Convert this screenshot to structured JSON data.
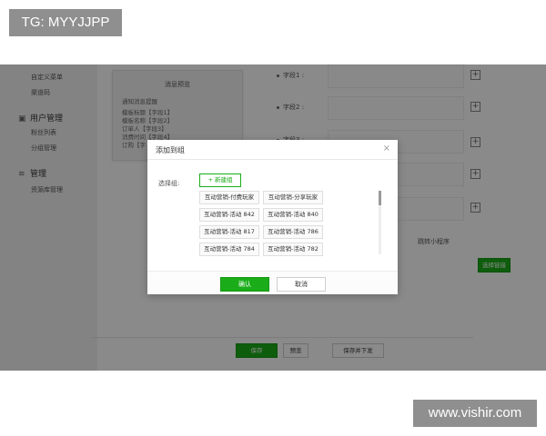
{
  "watermarks": {
    "top": "TG: MYYJJPP",
    "bottom": "www.vishir.com"
  },
  "sidebar": {
    "items_top": [
      "自定义菜单",
      "渠道码"
    ],
    "groups": [
      {
        "icon": "user-icon",
        "title": "用户管理",
        "items": [
          "粉丝列表",
          "分组管理"
        ]
      },
      {
        "icon": "manage-icon",
        "title": "管理",
        "items": [
          "资源库管理"
        ]
      }
    ]
  },
  "preview": {
    "title": "消息预览",
    "lines": [
      "通知消息提醒",
      "模板标题【字段1】",
      "模板名称【字段2】",
      "订单人【字段3】",
      "消费时间【字段4】",
      "订购【字"
    ]
  },
  "fields": [
    "字段1",
    "字段2",
    "字段3"
  ],
  "mini_program_label": "跳转小程序",
  "mini_program_button": "选择链接",
  "bottom_bar": {
    "save": "保存",
    "preview": "预览",
    "download": "保存并下发"
  },
  "modal": {
    "title": "添加到组",
    "close_glyph": "×",
    "select_label": "选择组:",
    "new_group_button": "+ 新建组",
    "groups": [
      "互动营销-付费玩家",
      "互动营销-分享玩家",
      "互动营销-活动 842",
      "互动营销-活动 840",
      "互动营销-活动 817",
      "互动营销-活动 786",
      "互动营销-活动 784",
      "互动营销-活动 782"
    ],
    "ok_button": "确认",
    "cancel_button": "取消"
  },
  "colors": {
    "primary_green": "#1aad19",
    "overlay": "rgba(0,0,0,0.46)"
  }
}
